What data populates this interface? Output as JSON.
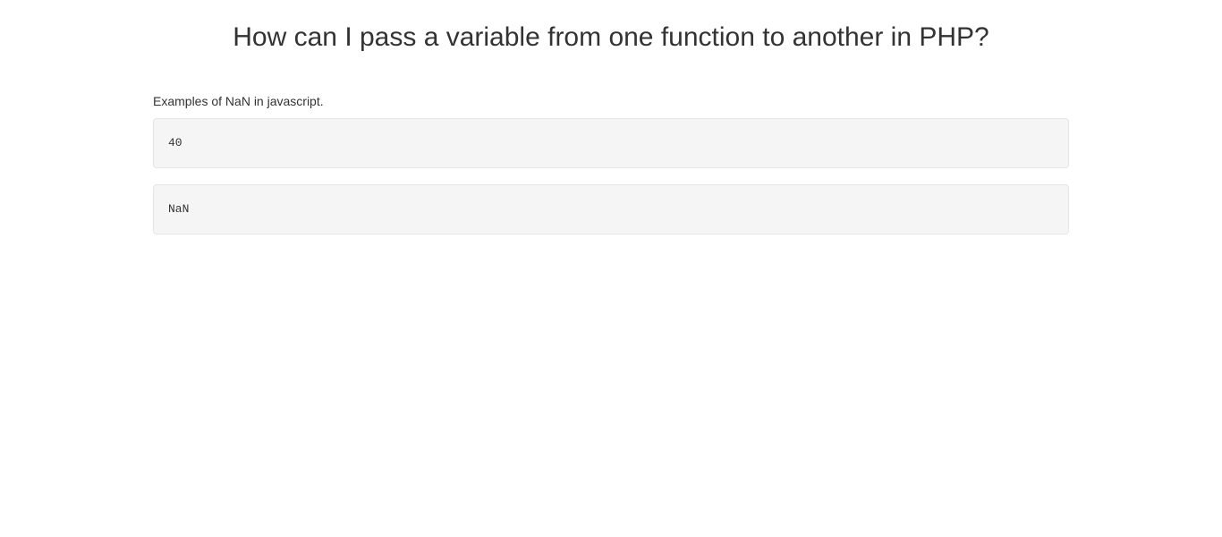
{
  "page": {
    "title": "How can I pass a variable from one function to another in PHP?"
  },
  "content": {
    "description": "Examples of NaN in javascript.",
    "code_blocks": [
      "40",
      "NaN"
    ]
  }
}
